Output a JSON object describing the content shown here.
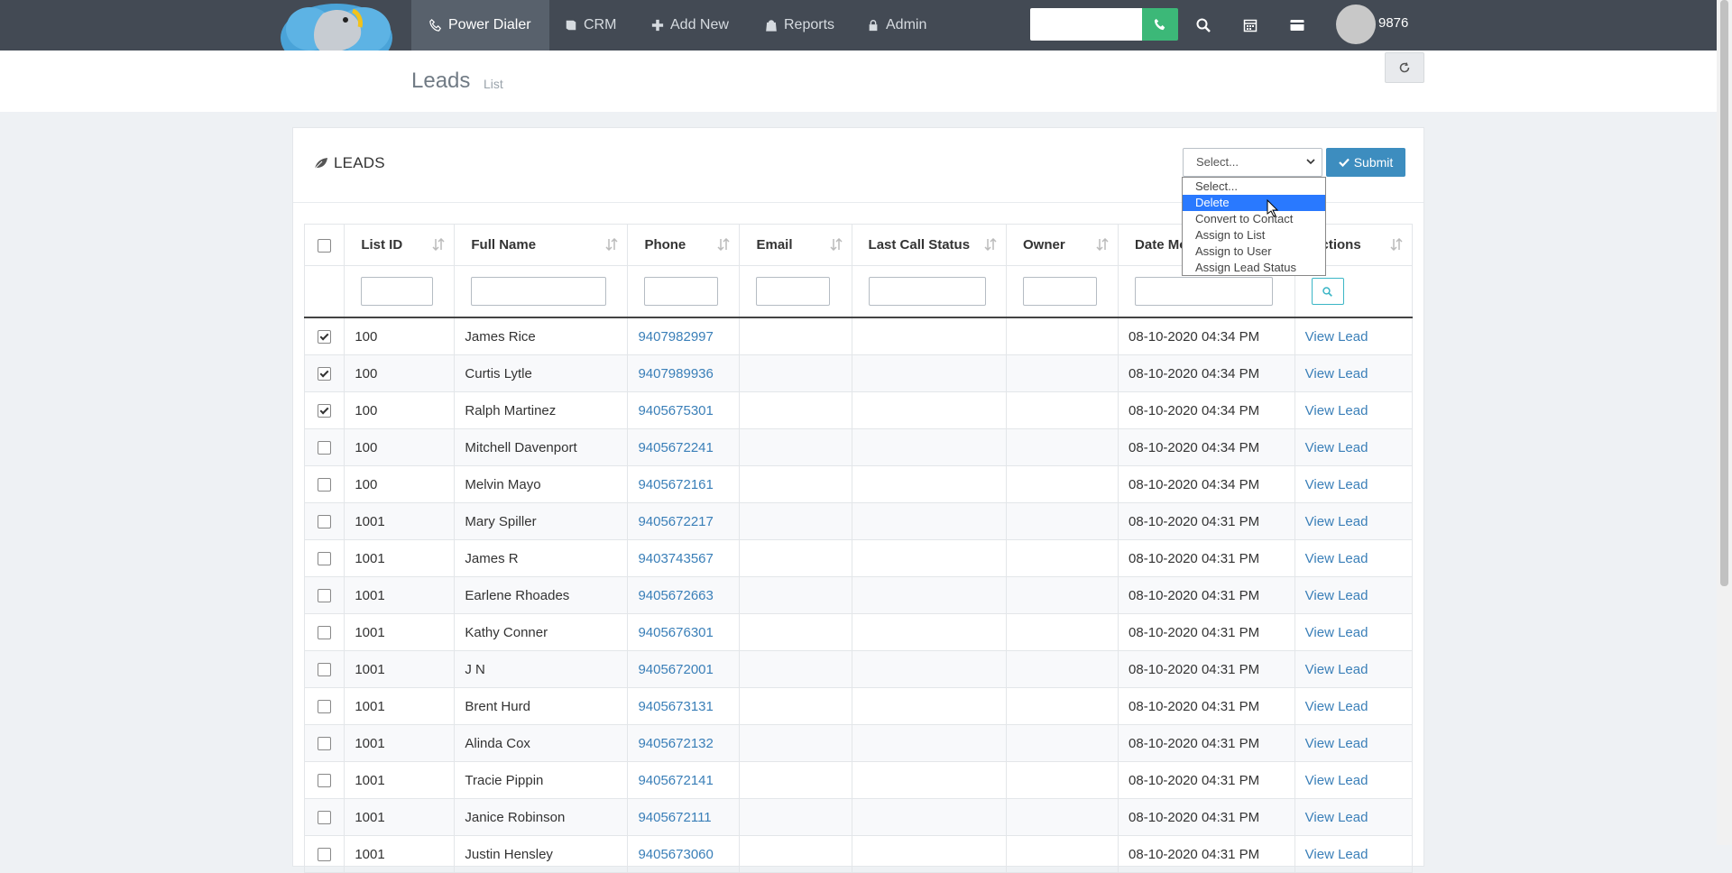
{
  "nav": {
    "items": [
      {
        "label": "Power Dialer",
        "icon": "phone-icon",
        "active": true
      },
      {
        "label": "CRM",
        "icon": "book-icon",
        "active": false
      },
      {
        "label": "Add New",
        "icon": "plus-icon",
        "active": false
      },
      {
        "label": "Reports",
        "icon": "bag-icon",
        "active": false
      },
      {
        "label": "Admin",
        "icon": "lock-icon",
        "active": false
      }
    ],
    "dial_value": "",
    "user_number": "9876"
  },
  "page": {
    "title": "Leads",
    "subtitle": "List"
  },
  "card": {
    "title": "LEADS",
    "select_value": "Select...",
    "submit_label": "Submit",
    "dropdown_options": [
      "Select...",
      "Delete",
      "Convert to Contact",
      "Assign to List",
      "Assign to User",
      "Assign Lead Status"
    ],
    "dropdown_selected": "Delete"
  },
  "table": {
    "columns": [
      "List ID",
      "Full Name",
      "Phone",
      "Email",
      "Last Call Status",
      "Owner",
      "Date Modified",
      "Actions"
    ],
    "rows": [
      {
        "checked": true,
        "list_id": "100",
        "name": "James Rice",
        "phone": "9407982997",
        "email": "",
        "status": "",
        "owner": "",
        "date": "08-10-2020 04:34 PM",
        "action": "View Lead"
      },
      {
        "checked": true,
        "list_id": "100",
        "name": "Curtis Lytle",
        "phone": "9407989936",
        "email": "",
        "status": "",
        "owner": "",
        "date": "08-10-2020 04:34 PM",
        "action": "View Lead"
      },
      {
        "checked": true,
        "list_id": "100",
        "name": "Ralph Martinez",
        "phone": "9405675301",
        "email": "",
        "status": "",
        "owner": "",
        "date": "08-10-2020 04:34 PM",
        "action": "View Lead"
      },
      {
        "checked": false,
        "list_id": "100",
        "name": "Mitchell Davenport",
        "phone": "9405672241",
        "email": "",
        "status": "",
        "owner": "",
        "date": "08-10-2020 04:34 PM",
        "action": "View Lead"
      },
      {
        "checked": false,
        "list_id": "100",
        "name": "Melvin Mayo",
        "phone": "9405672161",
        "email": "",
        "status": "",
        "owner": "",
        "date": "08-10-2020 04:34 PM",
        "action": "View Lead"
      },
      {
        "checked": false,
        "list_id": "1001",
        "name": "Mary Spiller",
        "phone": "9405672217",
        "email": "",
        "status": "",
        "owner": "",
        "date": "08-10-2020 04:31 PM",
        "action": "View Lead"
      },
      {
        "checked": false,
        "list_id": "1001",
        "name": "James R",
        "phone": "9403743567",
        "email": "",
        "status": "",
        "owner": "",
        "date": "08-10-2020 04:31 PM",
        "action": "View Lead"
      },
      {
        "checked": false,
        "list_id": "1001",
        "name": "Earlene Rhoades",
        "phone": "9405672663",
        "email": "",
        "status": "",
        "owner": "",
        "date": "08-10-2020 04:31 PM",
        "action": "View Lead"
      },
      {
        "checked": false,
        "list_id": "1001",
        "name": "Kathy Conner",
        "phone": "9405676301",
        "email": "",
        "status": "",
        "owner": "",
        "date": "08-10-2020 04:31 PM",
        "action": "View Lead"
      },
      {
        "checked": false,
        "list_id": "1001",
        "name": "J N",
        "phone": "9405672001",
        "email": "",
        "status": "",
        "owner": "",
        "date": "08-10-2020 04:31 PM",
        "action": "View Lead"
      },
      {
        "checked": false,
        "list_id": "1001",
        "name": "Brent Hurd",
        "phone": "9405673131",
        "email": "",
        "status": "",
        "owner": "",
        "date": "08-10-2020 04:31 PM",
        "action": "View Lead"
      },
      {
        "checked": false,
        "list_id": "1001",
        "name": "Alinda Cox",
        "phone": "9405672132",
        "email": "",
        "status": "",
        "owner": "",
        "date": "08-10-2020 04:31 PM",
        "action": "View Lead"
      },
      {
        "checked": false,
        "list_id": "1001",
        "name": "Tracie Pippin",
        "phone": "9405672141",
        "email": "",
        "status": "",
        "owner": "",
        "date": "08-10-2020 04:31 PM",
        "action": "View Lead"
      },
      {
        "checked": false,
        "list_id": "1001",
        "name": "Janice Robinson",
        "phone": "9405672111",
        "email": "",
        "status": "",
        "owner": "",
        "date": "08-10-2020 04:31 PM",
        "action": "View Lead"
      },
      {
        "checked": false,
        "list_id": "1001",
        "name": "Justin Hensley",
        "phone": "9405673060",
        "email": "",
        "status": "",
        "owner": "",
        "date": "08-10-2020 04:31 PM",
        "action": "View Lead"
      }
    ]
  }
}
